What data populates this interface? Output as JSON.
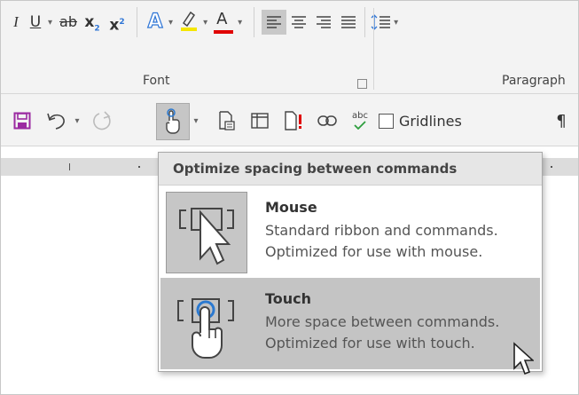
{
  "ribbon": {
    "font_group": {
      "label": "Font",
      "buttons": {
        "italic": "I",
        "underline": "U",
        "strikethrough": "ab",
        "subscript": "x",
        "subscript_mark": "2",
        "superscript": "x",
        "superscript_mark": "2",
        "text_effects": "A",
        "font_color": "A"
      }
    },
    "paragraph_group": {
      "label": "Paragraph"
    }
  },
  "qat": {
    "gridlines_label": "Gridlines",
    "pilcrow": "¶",
    "spelling_abc": "abc"
  },
  "menu": {
    "header": "Optimize spacing between commands",
    "items": [
      {
        "title": "Mouse",
        "desc_line1": "Standard ribbon and commands.",
        "desc_line2": "Optimized for use with mouse.",
        "icon": "mouse-mode-icon",
        "selected": true
      },
      {
        "title": "Touch",
        "desc_line1": "More space between commands.",
        "desc_line2": "Optimized for use with touch.",
        "icon": "touch-mode-icon",
        "hovered": true
      }
    ]
  },
  "colors": {
    "highlight_yellow": "#f5e600",
    "font_red": "#e00000",
    "text_effect_blue": "#2e75d6",
    "save_purple": "#9b2aa1",
    "touch_blue": "#2b79d0",
    "check_green": "#2e9e3e"
  }
}
